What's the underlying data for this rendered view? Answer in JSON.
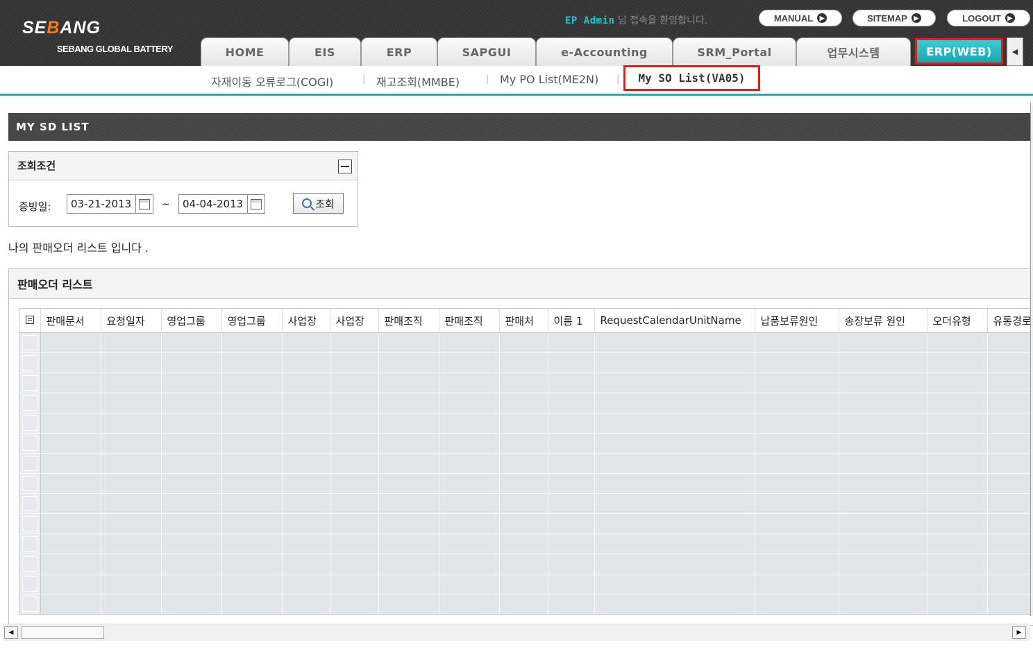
{
  "header": {
    "logo": {
      "brand_pre": "SE",
      "brand_hl": "B",
      "brand_post": "ANG",
      "subtitle": "SEBANG GLOBAL BATTERY"
    },
    "welcome_user": "EP Admin",
    "welcome_text": " 님 접속을 환영합니다.",
    "buttons": {
      "manual": "MANUAL",
      "sitemap": "SITEMAP",
      "logout": "LOGOUT"
    },
    "tabs": [
      "HOME",
      "EIS",
      "ERP",
      "SAPGUI",
      "e-Accounting",
      "SRM_Portal",
      "업무시스템",
      "ERP(WEB)"
    ],
    "active_tab": "ERP(WEB)",
    "accent_color": "#25b3bd",
    "highlight_color": "#e21b1b"
  },
  "subnav": {
    "items": [
      "자재이동 오류로그(COGI)",
      "재고조회(MMBE)",
      "My PO List(ME2N)",
      "My SO List(VA05)"
    ],
    "active": "My SO List(VA05)"
  },
  "page": {
    "title": "MY SD LIST",
    "condition_title": "조회조건",
    "date_label": "증빙일:",
    "date_from": "03-21-2013",
    "date_to": "04-04-2013",
    "tilde": "~",
    "search_label": "조회",
    "description": "나의 판매오더 리스트 입니다 .",
    "list_title": "판매오더 리스트"
  },
  "grid": {
    "columns": [
      "판매문서",
      "요청일자",
      "영업그룹",
      "영업그룹",
      "사업장",
      "사업장",
      "판매조직",
      "판매조직",
      "판매처",
      "이름 1",
      "RequestCalendarUnitName",
      "납품보류원인",
      "송장보류 원인",
      "오더유형",
      "유통경로"
    ],
    "rows": 15
  }
}
